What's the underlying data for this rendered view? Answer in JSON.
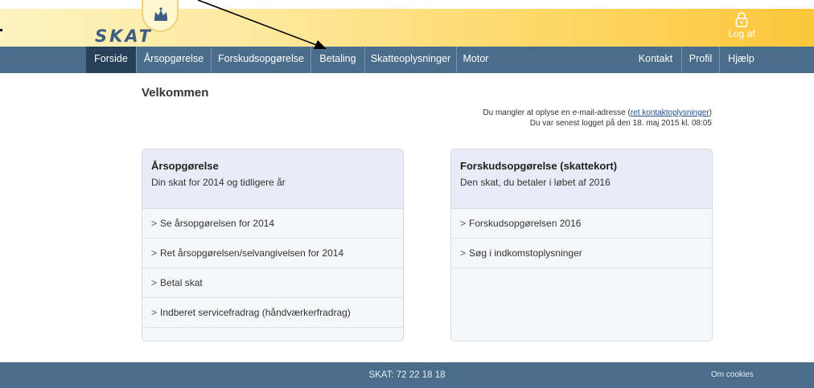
{
  "header": {
    "logo_text": "SKAT",
    "logout_label": "Log af"
  },
  "nav": {
    "items": [
      {
        "label": "Forside",
        "active": true
      },
      {
        "label": "Årsopgørelse"
      },
      {
        "label": "Forskudsopgørelse"
      },
      {
        "label": "Betaling"
      },
      {
        "label": "Skatteoplysninger"
      },
      {
        "label": "Motor"
      },
      {
        "label": "Kontakt"
      },
      {
        "label": "Profil"
      },
      {
        "label": "Hjælp"
      }
    ]
  },
  "main": {
    "welcome": "Velkommen",
    "notice_line1_prefix": "Du mangler at oplyse en e-mail-adresse (",
    "notice_line1_link": "ret kontaktoplysninger",
    "notice_line1_suffix": ")",
    "notice_line2": "Du var senest logget på den 18. maj 2015 kl. 08:05"
  },
  "cards": [
    {
      "title": "Årsopgørelse",
      "subtitle": "Din skat for 2014 og tidligere år",
      "links": [
        "Se årsopgørelsen for 2014",
        "Ret årsopgørelsen/selvangivelsen for 2014",
        "Betal skat",
        "Indberet servicefradrag (håndværkerfradrag)"
      ]
    },
    {
      "title": "Forskudsopgørelse (skattekort)",
      "subtitle": "Den skat, du betaler i løbet af 2016",
      "links": [
        "Forskudsopgørelsen 2016",
        "Søg i indkomstoplysninger"
      ]
    }
  ],
  "footer": {
    "phone": "SKAT: 72 22 18 18",
    "cookies": "Om cookies"
  },
  "icons": {
    "crown": "crown-icon",
    "lock": "lock-icon",
    "chevron": "chevron-right-icon"
  },
  "colors": {
    "nav_bg": "#4a6d8c",
    "nav_active": "#27405a",
    "header_gradient_end": "#fcc63a",
    "card_head": "#e9ecf6"
  }
}
